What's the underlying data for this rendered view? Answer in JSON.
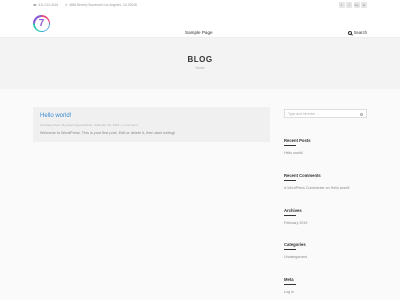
{
  "topbar": {
    "phone": "611-012-4416",
    "address": "4558 Beverly Boulevard Los Angeles, CA 90048",
    "social": [
      "f",
      "t",
      "G+",
      "in"
    ]
  },
  "header": {
    "logo_text": "7",
    "nav_link": "Sample Page",
    "search_label": "Search"
  },
  "hero": {
    "title": "BLOG",
    "breadcrumb": "Home"
  },
  "post": {
    "title": "Hello world!",
    "meta": "Uncategorized • By jaclynnguyenadmin • February 25, 2019 • 1 Comment",
    "excerpt": "Welcome to WordPress. This is your first post. Edit or delete it, then start writing!"
  },
  "sidebar": {
    "search_placeholder": "Type and hit enter ...",
    "widgets": [
      {
        "title": "Recent Posts",
        "items": [
          "Hello world!"
        ]
      },
      {
        "title": "Recent Comments",
        "items": [
          "A WordPress Commenter on Hello world!"
        ]
      },
      {
        "title": "Archives",
        "items": [
          "February 2019"
        ]
      },
      {
        "title": "Categories",
        "items": [
          "Uncategorized"
        ]
      },
      {
        "title": "Meta",
        "items": [
          "Log in"
        ]
      }
    ]
  }
}
